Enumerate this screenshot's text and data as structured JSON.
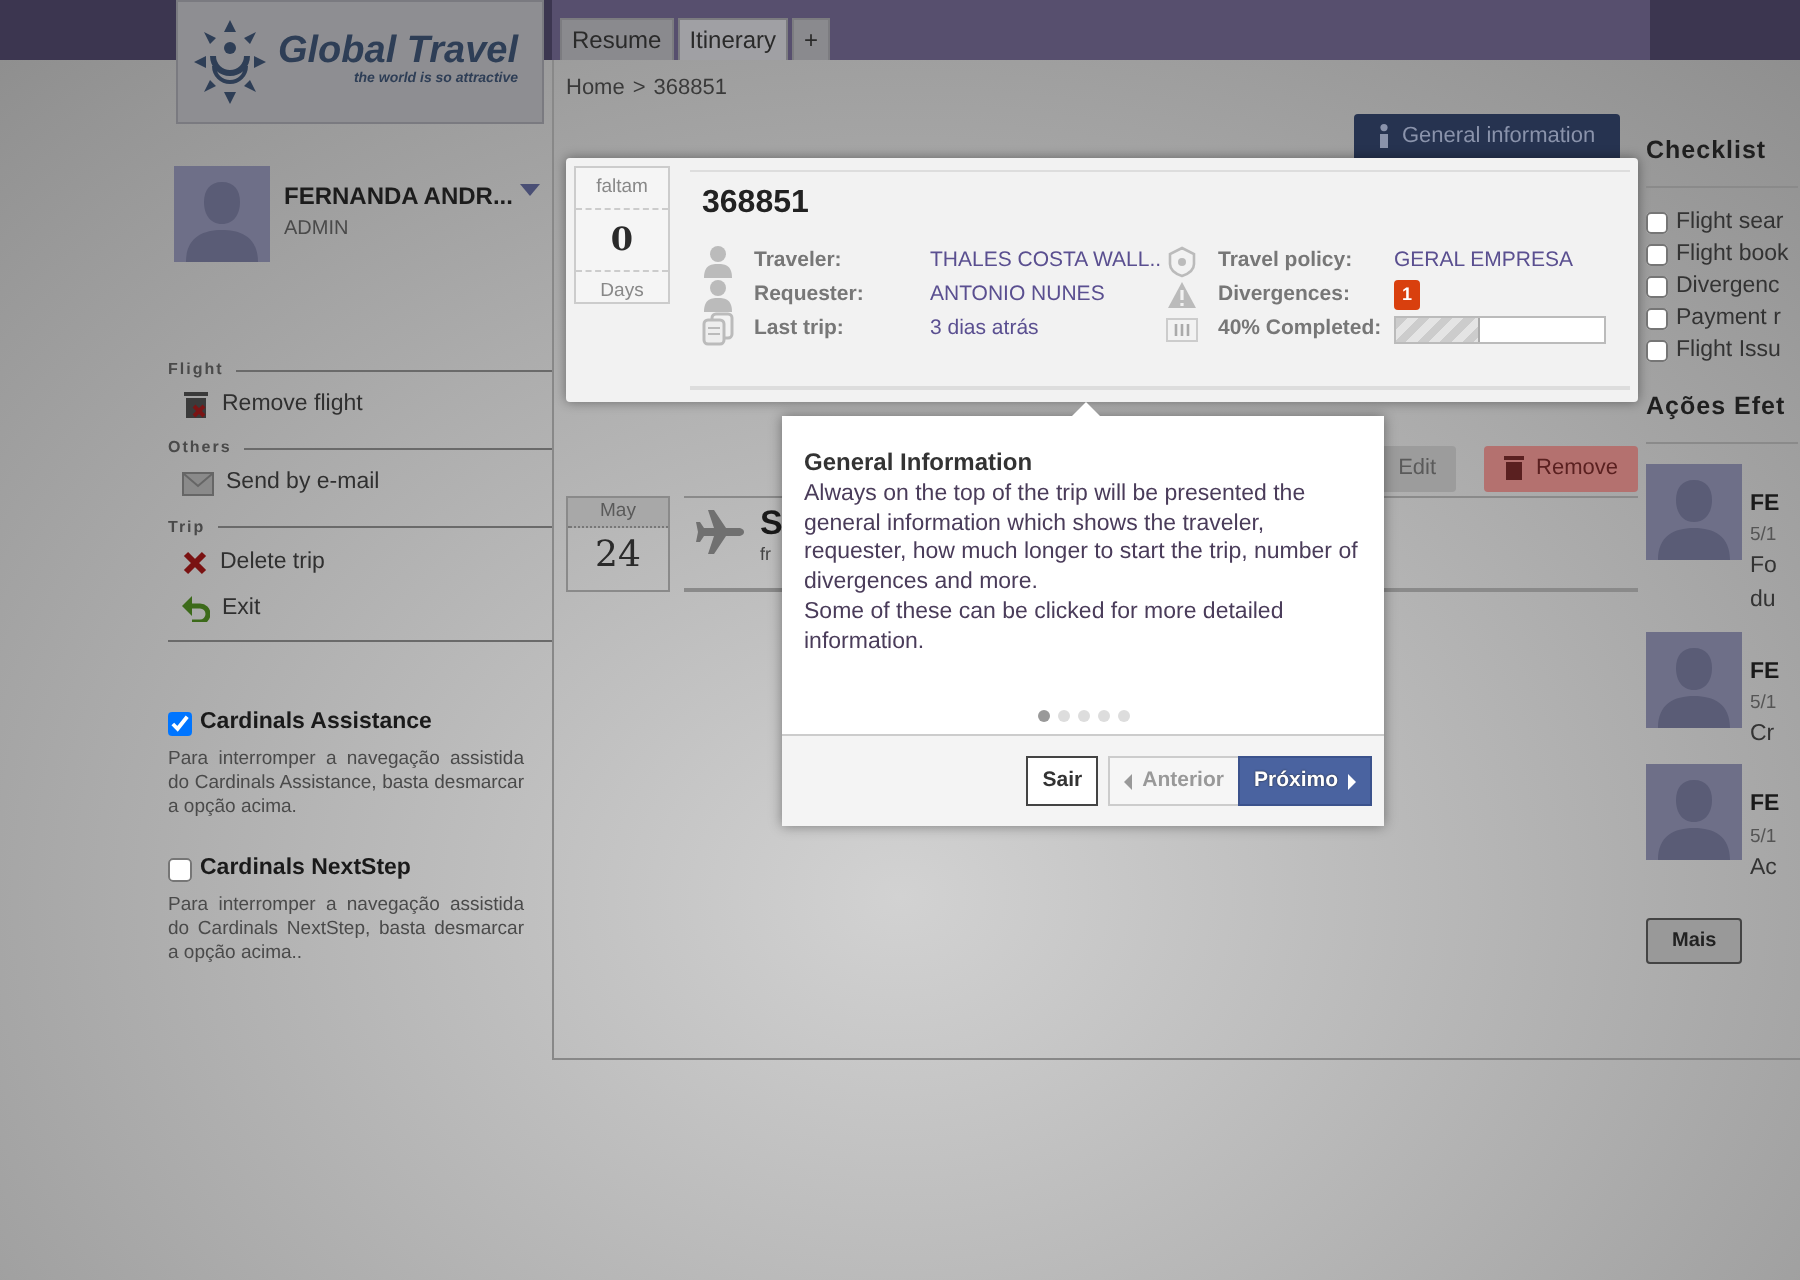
{
  "header": {
    "logo_title": "Global Travel",
    "logo_tagline": "the world is so attractive"
  },
  "tabs": [
    {
      "label": "Resume",
      "selected": false
    },
    {
      "label": "Itinerary",
      "selected": true
    },
    {
      "label": "+",
      "selected": false
    }
  ],
  "breadcrumb": {
    "items": [
      "Home",
      "368851"
    ],
    "separator": ">"
  },
  "user": {
    "name": "FERNANDA ANDR...",
    "role": "ADMIN"
  },
  "menu": [
    {
      "heading": "Flight",
      "items": [
        {
          "kind": "trash",
          "label": "Remove flight"
        }
      ]
    },
    {
      "heading": "Others",
      "items": [
        {
          "kind": "mail",
          "label": "Send by e-mail"
        }
      ]
    },
    {
      "heading": "Trip",
      "items": [
        {
          "kind": "delete",
          "label": "Delete trip"
        },
        {
          "kind": "exit",
          "label": "Exit"
        }
      ]
    }
  ],
  "options": [
    {
      "label": "Cardinals Assistance",
      "checked": true,
      "description": "Para interromper a navegação assistida do Cardinals Assistance, basta desmarcar a opção acima."
    },
    {
      "label": "Cardinals NextStep",
      "checked": false,
      "description": "Para interromper a navegação assistida do Cardinals NextStep, basta desmarcar a opção acima.."
    }
  ],
  "general_info_button": "General information",
  "trip_summary": {
    "countdown_top": "faltam",
    "countdown_value": "0",
    "countdown_bottom": "Days",
    "id": "368851",
    "left_fields": [
      {
        "kind": "traveler",
        "label": "Traveler:",
        "value": "THALES COSTA WALL.."
      },
      {
        "kind": "requester",
        "label": "Requester:",
        "value": "ANTONIO NUNES"
      },
      {
        "kind": "last_trip",
        "label": "Last trip:",
        "value": "3 dias atrás"
      }
    ],
    "right_fields": [
      {
        "kind": "policy",
        "label": "Travel policy:",
        "value": "GERAL EMPRESA"
      },
      {
        "kind": "divergences",
        "label": "Divergences:",
        "badge": "1"
      },
      {
        "kind": "progress",
        "label": "40% Completed:",
        "level": 0.4
      }
    ]
  },
  "segment_buttons": [
    {
      "kind": "default",
      "label": "Edit"
    },
    {
      "kind": "danger",
      "label": "Remove"
    }
  ],
  "segment": {
    "month": "May",
    "day": "24",
    "title": "S",
    "subtitle": "fr"
  },
  "checklist": {
    "title": "Checklist",
    "items": [
      {
        "label": "Flight sear",
        "checked": false
      },
      {
        "label": "Flight book",
        "checked": false
      },
      {
        "label": "Divergenc",
        "checked": false
      },
      {
        "label": "Payment r",
        "checked": false
      },
      {
        "label": "Flight Issu",
        "checked": false
      }
    ]
  },
  "actions": {
    "title": "Ações Efet",
    "entries": [
      {
        "name": "FE",
        "date": "5/1",
        "lines": [
          "Fo",
          "du"
        ]
      },
      {
        "name": "FE",
        "date": "5/1",
        "lines": [
          "Cr"
        ]
      },
      {
        "name": "FE",
        "date": "5/1",
        "lines": [
          "Ac"
        ]
      }
    ],
    "more": "Mais"
  },
  "tour": {
    "title": "General Information",
    "paragraphs": [
      "Always on the top of the trip will be presented the general information which shows the traveler, requester, how much longer to start the trip, number of divergences and more.",
      "Some of these can be clicked for more detailed information."
    ],
    "steps": [
      {
        "selected": true
      },
      {
        "selected": false
      },
      {
        "selected": false
      },
      {
        "selected": false
      },
      {
        "selected": false
      }
    ],
    "buttons": [
      {
        "kind": "exit",
        "label": "Sair",
        "disabled": false
      },
      {
        "kind": "prev",
        "label": "Anterior",
        "disabled": true
      },
      {
        "kind": "next",
        "label": "Próximo",
        "disabled": false
      }
    ]
  }
}
